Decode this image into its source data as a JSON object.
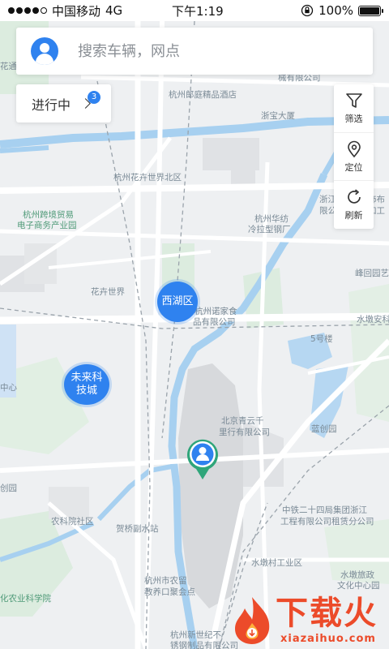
{
  "status_bar": {
    "carrier": "中国移动",
    "network": "4G",
    "time": "下午1:19",
    "battery": "100%",
    "battery_level": 1.0
  },
  "search": {
    "placeholder": "搜索车辆，网点"
  },
  "in_progress": {
    "label": "进行中",
    "badge": "3"
  },
  "tools": [
    {
      "label": "筛选",
      "icon": "filter-icon"
    },
    {
      "label": "定位",
      "icon": "location-icon"
    },
    {
      "label": "刷新",
      "icon": "refresh-icon"
    }
  ],
  "districts": [
    {
      "label": "西湖区"
    },
    {
      "label": "未来科技城"
    }
  ],
  "map_labels": {
    "l1": "杭州郎庭精品酒店",
    "l2": "浙宝大厦",
    "l3": "杭州花卉世界北区",
    "l4": "杭州跨境贸易",
    "l5": "电子商务产业园",
    "l6": "杭州华纺",
    "l7": "冷拉型钢厂",
    "l8": "花卉世界",
    "l9": "杭州诺家食",
    "l10": "品有限公司",
    "l11": "5号楼",
    "l12": "北京青云千",
    "l13": "里行有限公司",
    "l14": "蓝创园",
    "l15": "中铁二十四局集团浙江",
    "l16": "工程有限公司租赁分公司",
    "l17": "农科院社区",
    "l18": "贺桥副水站",
    "l19": "水墩村工业区",
    "l20": "水墩旅政",
    "l21": "文化中心园",
    "l22": "杭州市农留",
    "l23": "教养口聚会点",
    "l24": "杭州新世纪不",
    "l25": "锈钢制品有限公司",
    "l26": "峰回园艺",
    "l27": "水墩安科",
    "l28": "械有限公司",
    "l29": "浙江",
    "l30": "限公",
    "l31": "饰布",
    "l32": "加工",
    "l33": "中心",
    "l34": "化农业科学院",
    "l35": "创园",
    "l36": "花通"
  },
  "watermark": {
    "text": "下载火",
    "sub": "xiazaihuo.com"
  },
  "colors": {
    "accent": "#2f82ef",
    "pin": "#2fa57a",
    "river": "#9cc9ee",
    "green_area": "#d9ecdf",
    "watermark": "#ec4b2a"
  }
}
